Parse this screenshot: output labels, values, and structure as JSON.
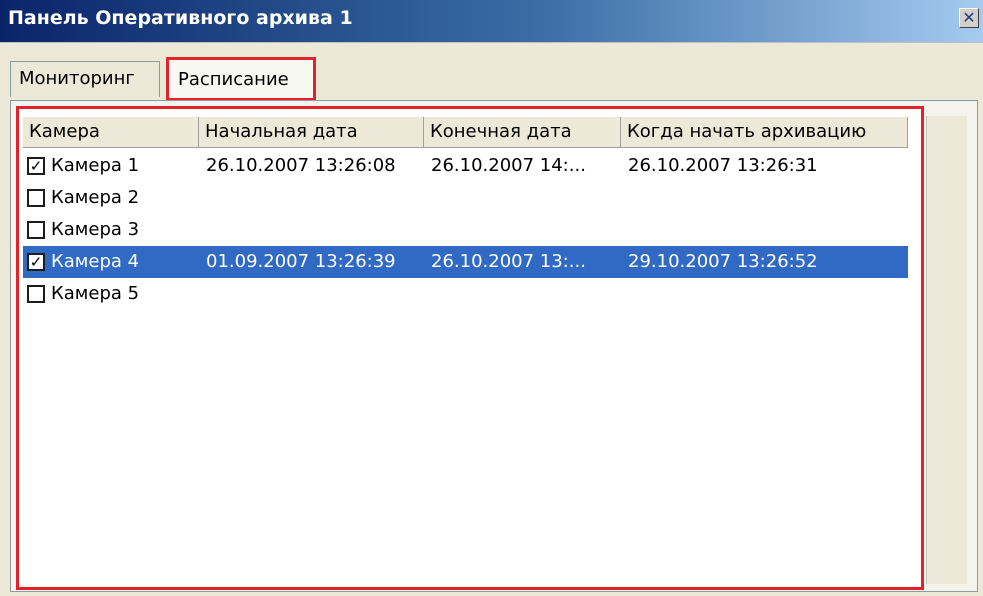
{
  "window": {
    "title": "Панель Оперативного архива 1",
    "close_icon": "close-icon"
  },
  "tabs": [
    {
      "label": "Мониторинг",
      "active": false
    },
    {
      "label": "Расписание",
      "active": true
    }
  ],
  "table": {
    "headers": [
      "Камера",
      "Начальная дата",
      "Конечная дата",
      "Когда начать архивацию"
    ],
    "rows": [
      {
        "camera": "Камера 1",
        "checked": true,
        "start": "26.10.2007 13:26:08",
        "end": "26.10.2007 14:...",
        "archive_start": "26.10.2007 13:26:31",
        "selected": false
      },
      {
        "camera": "Камера 2",
        "checked": false,
        "start": "",
        "end": "",
        "archive_start": "",
        "selected": false
      },
      {
        "camera": "Камера 3",
        "checked": false,
        "start": "",
        "end": "",
        "archive_start": "",
        "selected": false
      },
      {
        "camera": "Камера 4",
        "checked": true,
        "start": "01.09.2007 13:26:39",
        "end": "26.10.2007 13:...",
        "archive_start": "29.10.2007 13:26:52",
        "selected": true
      },
      {
        "camera": "Камера 5",
        "checked": false,
        "start": "",
        "end": "",
        "archive_start": "",
        "selected": false
      }
    ]
  },
  "colors": {
    "highlight": "#e2232a",
    "selection": "#316ac5"
  }
}
